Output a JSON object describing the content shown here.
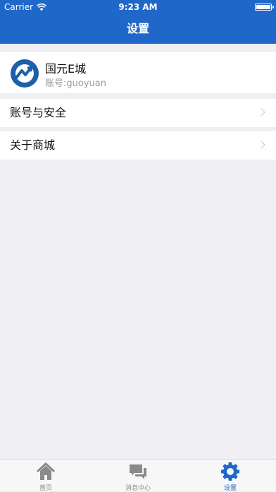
{
  "status_bar": {
    "carrier": "Carrier",
    "time": "9:23 AM"
  },
  "header": {
    "title": "设置"
  },
  "profile": {
    "name": "国元E城",
    "account": "账号:guoyuan"
  },
  "menu": [
    {
      "label": "账号与安全"
    },
    {
      "label": "关于商城"
    }
  ],
  "tabbar": {
    "items": [
      {
        "label": "首页",
        "icon": "home-icon"
      },
      {
        "label": "消息中心",
        "icon": "chat-icon"
      },
      {
        "label": "设置",
        "icon": "gear-icon",
        "active": true
      }
    ]
  },
  "colors": {
    "primary": "#1f68c9",
    "background": "#efeff4",
    "inactive": "#8a8a8a"
  }
}
